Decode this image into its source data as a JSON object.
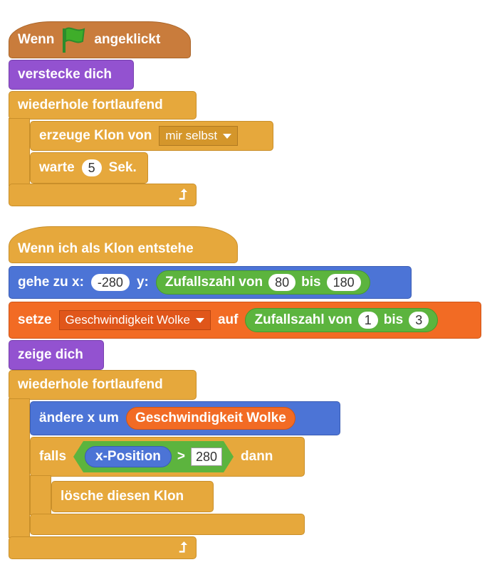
{
  "script1": {
    "hat_when": "Wenn",
    "hat_clicked": "angeklickt",
    "hide": "verstecke dich",
    "forever": "wiederhole fortlaufend",
    "create_clone": "erzeuge Klon von",
    "clone_target": "mir selbst",
    "wait": "warte",
    "wait_value": "5",
    "wait_unit": "Sek."
  },
  "script2": {
    "hat": "Wenn ich als Klon entstehe",
    "goto_prefix": "gehe zu x:",
    "goto_x": "-280",
    "goto_y_label": "y:",
    "random_label": "Zufallszahl von",
    "random_to": "bis",
    "random_y_from": "80",
    "random_y_to": "180",
    "set_label": "setze",
    "set_var": "Geschwindigkeit Wolke",
    "set_to": "auf",
    "random_speed_from": "1",
    "random_speed_to": "3",
    "show": "zeige dich",
    "forever": "wiederhole fortlaufend",
    "change_x": "ändere x um",
    "change_var": "Geschwindigkeit Wolke",
    "if_label": "falls",
    "x_position": "x-Position",
    "gt": ">",
    "compare_value": "280",
    "then": "dann",
    "delete_clone": "lösche diesen Klon"
  },
  "colors": {
    "control": "#e6a83c",
    "events": "#c97c3c",
    "looks": "#9352d0",
    "motion": "#4c74d6",
    "variables": "#f26b24",
    "operators": "#5cb43e"
  },
  "icons": {
    "flag": "green-flag-icon",
    "loop": "loop-arrow-icon"
  }
}
